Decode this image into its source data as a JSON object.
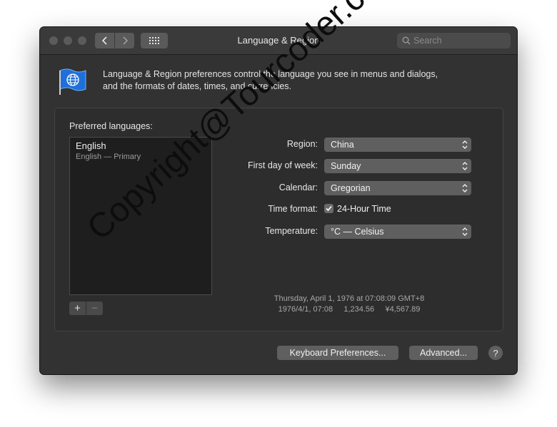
{
  "window": {
    "title": "Language & Region",
    "search_placeholder": "Search"
  },
  "header": {
    "description_line1": "Language & Region preferences control the language you see in menus and dialogs,",
    "description_line2": "and the formats of dates, times, and currencies.",
    "icon": "flag-globe-icon"
  },
  "languages": {
    "label": "Preferred languages:",
    "items": [
      {
        "name": "English",
        "detail": "English — Primary"
      }
    ],
    "add_label": "+",
    "remove_label": "−"
  },
  "settings": {
    "region": {
      "label": "Region:",
      "value": "China"
    },
    "first_day": {
      "label": "First day of week:",
      "value": "Sunday"
    },
    "calendar": {
      "label": "Calendar:",
      "value": "Gregorian"
    },
    "time_format": {
      "label": "Time format:",
      "checkbox_label": "24-Hour Time",
      "checked": true
    },
    "temperature": {
      "label": "Temperature:",
      "value": "°C — Celsius"
    }
  },
  "sample": {
    "line1": "Thursday, April 1, 1976 at 07:08:09 GMT+8",
    "line2": "1976/4/1, 07:08     1,234.56     ¥4,567.89"
  },
  "buttons": {
    "keyboard": "Keyboard Preferences...",
    "advanced": "Advanced...",
    "help": "?"
  },
  "watermark": "Copyright@Tourcoder.com",
  "colors": {
    "window_bg": "#323232",
    "titlebar_bg": "#3a3a3a",
    "flag_blue": "#1e6fd9"
  }
}
